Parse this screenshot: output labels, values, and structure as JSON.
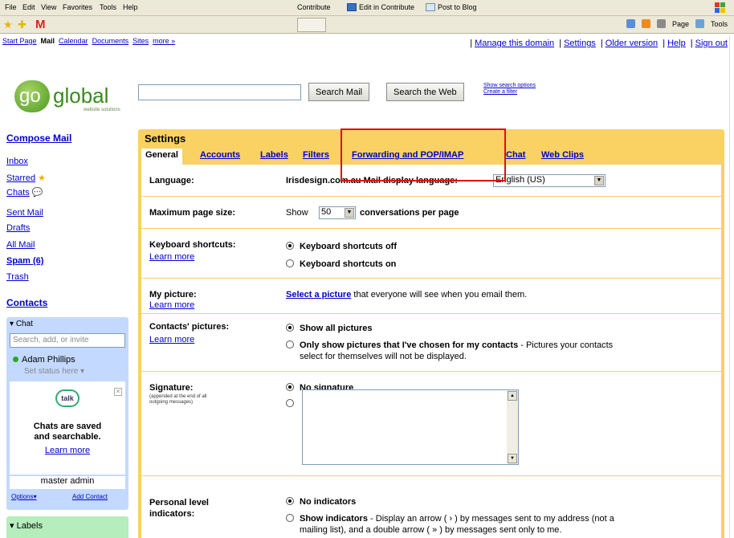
{
  "browser": {
    "menu": [
      "File",
      "Edit",
      "View",
      "Favorites",
      "Tools",
      "Help"
    ],
    "contribute": "Contribute",
    "edit_in_contribute": "Edit in Contribute",
    "post_to_blog": "Post to Blog",
    "toolbar_page": "Page",
    "toolbar_tools": "Tools"
  },
  "gmail": {
    "top_links": [
      "Start Page",
      "Mail",
      "Calendar",
      "Documents",
      "Sites",
      "more »"
    ],
    "right_links": [
      "Manage this domain",
      "Settings",
      "Older version",
      "Help",
      "Sign out"
    ],
    "logo": {
      "go": "go",
      "global": "global",
      "tagline": "website solutions"
    },
    "search": {
      "mail_button": "Search Mail",
      "web_button": "Search the Web",
      "show_options": "Show search options",
      "create_filter": "Create a filter"
    },
    "nav": {
      "compose": "Compose Mail",
      "inbox": "Inbox",
      "starred": "Starred",
      "chats": "Chats",
      "sent": "Sent Mail",
      "drafts": "Drafts",
      "all_mail": "All Mail",
      "spam": "Spam (6)",
      "trash": "Trash",
      "contacts": "Contacts"
    },
    "chat": {
      "header": "Chat",
      "search_placeholder": "Search, add, or invite",
      "user": "Adam Phillips",
      "status": "Set status here",
      "talk": "talk",
      "promo_line1": "Chats are saved",
      "promo_line2": "and searchable.",
      "learn_more": "Learn more",
      "admin": "master admin",
      "options": "Options",
      "add_contact": "Add Contact"
    },
    "labels_header": "Labels"
  },
  "settings": {
    "title": "Settings",
    "tabs": [
      "General",
      "Accounts",
      "Labels",
      "Filters",
      "Forwarding and POP/IMAP",
      "Chat",
      "Web Clips"
    ],
    "active_tab": "General",
    "language": {
      "label": "Language:",
      "text": "Irisdesign.com.au Mail display language:",
      "value": "English (US)"
    },
    "page_size": {
      "label": "Maximum page size:",
      "show": "Show",
      "value": "50",
      "suffix": "conversations per page"
    },
    "keyboard": {
      "label": "Keyboard shortcuts:",
      "learn_more": "Learn more",
      "off": "Keyboard shortcuts off",
      "on": "Keyboard shortcuts on",
      "selected": "off"
    },
    "picture": {
      "label": "My picture:",
      "learn_more": "Learn more",
      "link": "Select a picture",
      "text": "that everyone will see when you email them."
    },
    "contacts_pictures": {
      "label": "Contacts' pictures:",
      "learn_more": "Learn more",
      "all": "Show all pictures",
      "chosen_bold": "Only show pictures that I've chosen for my contacts",
      "chosen_rest": "- Pictures your contacts",
      "chosen_line2": "select for themselves will not be displayed."
    },
    "signature": {
      "label": "Signature:",
      "note_line1": "(appended at the end of all",
      "note_line2": "outgoing messages)",
      "none": "No signature"
    },
    "indicators": {
      "label_line1": "Personal level",
      "label_line2": "indicators:",
      "none": "No indicators",
      "show_bold": "Show indicators",
      "show_rest": "- Display an arrow ( › ) by messages sent to my address (not a",
      "show_line2": "mailing list), and a double arrow ( » ) by messages sent only to me."
    }
  },
  "colors": {
    "settings_bg": "#fad163",
    "chat_bg": "#c3d9ff",
    "labels_bg": "#b5edbc",
    "link": "#0000cc",
    "highlight": "#e01010"
  }
}
